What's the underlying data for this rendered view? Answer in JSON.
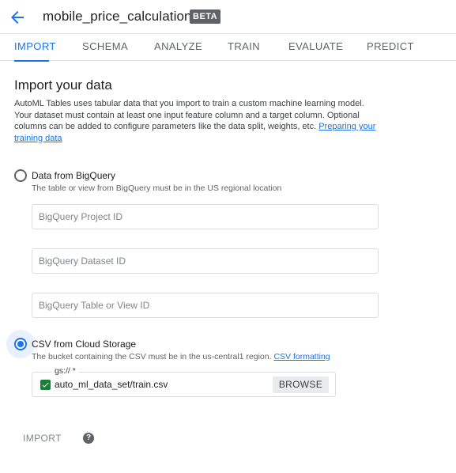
{
  "header": {
    "title": "mobile_price_calculation",
    "badge": "BETA",
    "back_icon": "arrow-back-icon"
  },
  "tabs": [
    {
      "label": "IMPORT",
      "active": true
    },
    {
      "label": "SCHEMA",
      "active": false
    },
    {
      "label": "ANALYZE",
      "active": false
    },
    {
      "label": "TRAIN",
      "active": false
    },
    {
      "label": "EVALUATE",
      "active": false
    },
    {
      "label": "PREDICT",
      "active": false
    }
  ],
  "main": {
    "title": "Import your data",
    "description": "AutoML Tables uses tabular data that you import to train a custom machine learning model. Your dataset must contain at least one input feature column and a target column. Optional columns can be added to configure parameters like the data split, weights, etc. ",
    "description_link": "Preparing your training data"
  },
  "bigquery": {
    "label": "Data from BigQuery",
    "selected": false,
    "hint": "The table or view from BigQuery must be in the US regional location",
    "project_placeholder": "BigQuery Project ID",
    "dataset_placeholder": "BigQuery Dataset ID",
    "table_placeholder": "BigQuery Table or View ID"
  },
  "csv": {
    "label": "CSV from Cloud Storage",
    "selected": true,
    "hint": "The bucket containing the CSV must be in the us-central1 region. ",
    "hint_link": "CSV formatting",
    "field_label": "gs:// *",
    "value": "auto_ml_data_set/train.csv",
    "browse_label": "BROWSE"
  },
  "footer": {
    "import_label": "IMPORT",
    "help_icon": "help-icon",
    "help_glyph": "?"
  },
  "colors": {
    "accent": "#1a73e8",
    "check": "#188038",
    "badge_bg": "#5f6368"
  }
}
